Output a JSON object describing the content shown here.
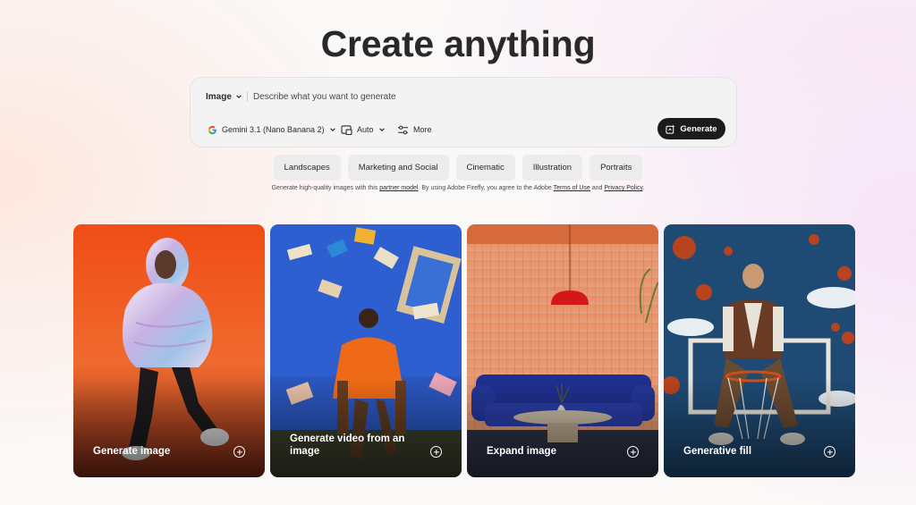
{
  "headline": "Create anything",
  "prompt": {
    "type_label": "Image",
    "placeholder": "Describe what you want to generate",
    "value": "",
    "model_label": "Gemini 3.1 (Nano Banana 2)",
    "aspect_label": "Auto",
    "more_label": "More",
    "generate_label": "Generate",
    "icons": [
      "google-logo-icon",
      "aspect-ratio-icon",
      "sliders-icon",
      "sparkle-generate-icon",
      "chevron-down-icon"
    ]
  },
  "chips": [
    "Landscapes",
    "Marketing and Social",
    "Cinematic",
    "Illustration",
    "Portraits"
  ],
  "disclaimer": {
    "part1": "Generate high-quality images with this ",
    "link1": "partner model",
    "part2": ". By using Adobe Firefly, you agree to the Adobe ",
    "link2": "Terms of Use",
    "part3": " and ",
    "link3": "Privacy Policy",
    "part4": "."
  },
  "cards": [
    {
      "label": "Generate image",
      "icon": "plus-circle-icon"
    },
    {
      "label": "Generate video from an image",
      "icon": "plus-circle-icon"
    },
    {
      "label": "Expand image",
      "icon": "plus-circle-icon"
    },
    {
      "label": "Generative fill",
      "icon": "plus-circle-icon"
    }
  ],
  "colors": {
    "generate_button": "#1b1b1b",
    "chip_background": "#ececec",
    "prompt_background": "#f3f3f3"
  }
}
